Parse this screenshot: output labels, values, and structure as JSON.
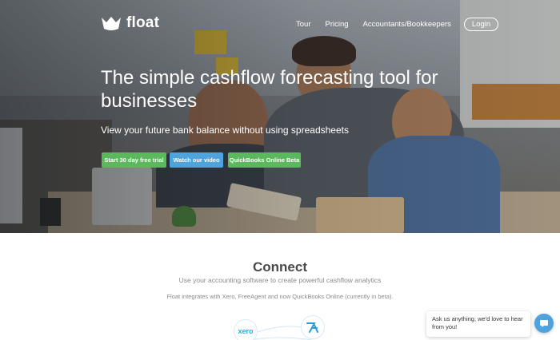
{
  "brand": {
    "name": "float",
    "logo_icon": "float-crown-logo",
    "text_color": "#ffffff"
  },
  "nav": {
    "items": [
      {
        "label": "Tour"
      },
      {
        "label": "Pricing"
      },
      {
        "label": "Accountants/Bookkeepers"
      }
    ],
    "login_label": "Login"
  },
  "hero": {
    "headline": "The simple cashflow forecasting tool for businesses",
    "subhead": "View your future bank balance without using spreadsheets",
    "buttons": {
      "trial": "Start 30 day free trial",
      "video": "Watch our video",
      "quickbooks": "QuickBooks Online Beta"
    },
    "colors": {
      "green": "#5cb85c",
      "blue": "#4ea3dc"
    }
  },
  "connect": {
    "title": "Connect",
    "subtitle": "Use your accounting software to create powerful cashflow analytics",
    "description": "Float integrates with Xero, FreeAgent and now QuickBooks Online (currently in beta).",
    "logos": {
      "xero": "xero",
      "freeagent_icon": "freeagent-logo-icon"
    }
  },
  "chat": {
    "message": "Ask us anything, we'd love to hear from you!",
    "icon": "chat-bubble-icon"
  }
}
